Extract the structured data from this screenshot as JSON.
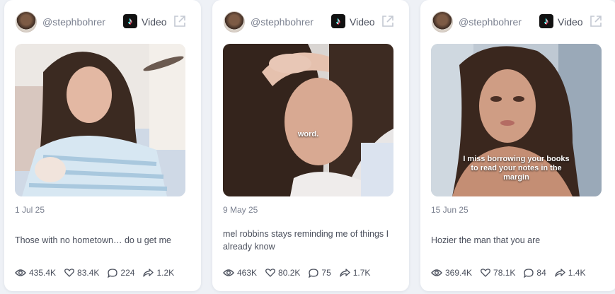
{
  "cards": [
    {
      "handle": "@stephbohrer",
      "type": "Video",
      "overlay_text": "",
      "date": "1 Jul 25",
      "caption": "Those with no hometown… do u get me",
      "views": "435.4K",
      "likes": "83.4K",
      "comments": "224",
      "shares": "1.2K"
    },
    {
      "handle": "@stephbohrer",
      "type": "Video",
      "overlay_text": "word.",
      "date": "9 May 25",
      "caption": "mel robbins stays reminding me of things I already know",
      "views": "463K",
      "likes": "80.2K",
      "comments": "75",
      "shares": "1.7K"
    },
    {
      "handle": "@stephbohrer",
      "type": "Video",
      "overlay_text": "I miss borrowing your books to read your notes in the margin",
      "date": "15 Jun 25",
      "caption": "Hozier the man that you are",
      "views": "369.4K",
      "likes": "78.1K",
      "comments": "84",
      "shares": "1.4K"
    }
  ]
}
